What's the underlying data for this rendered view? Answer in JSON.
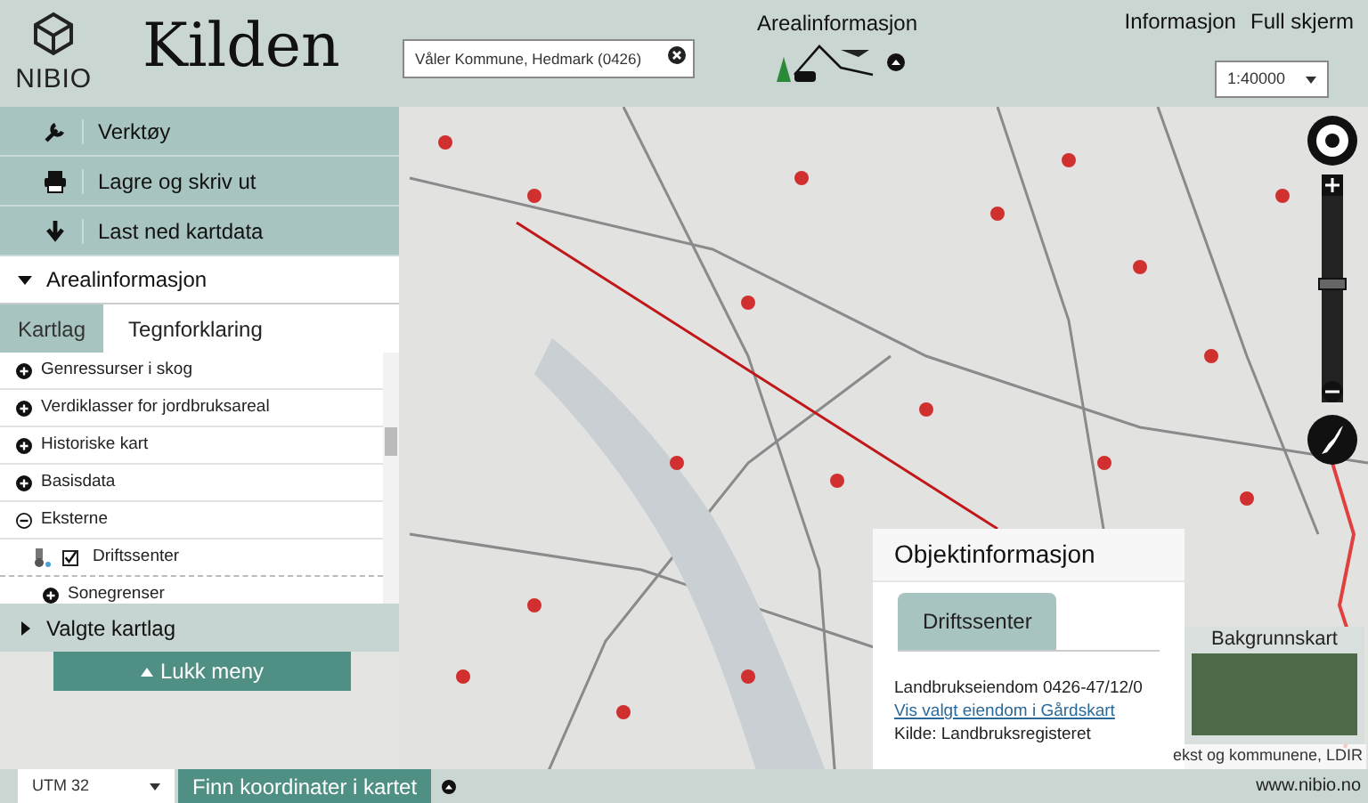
{
  "header": {
    "logo_text": "NIBIO",
    "app_title": "Kilden",
    "search": {
      "value": "Våler Kommune, Hedmark (0426)"
    },
    "theme": {
      "label": "Arealinformasjon"
    },
    "links": [
      "Informasjon",
      "Full skjerm"
    ],
    "scale": {
      "value": "1:40000"
    }
  },
  "menu": {
    "tools": [
      {
        "label": "Verktøy",
        "kind": "wrench"
      },
      {
        "label": "Lagre og skriv ut",
        "kind": "printer"
      },
      {
        "label": "Last ned kartdata",
        "kind": "download"
      }
    ],
    "section": {
      "label": "Arealinformasjon",
      "expanded": true
    },
    "tabs": [
      {
        "label": "Kartlag",
        "selected": true
      },
      {
        "label": "Tegnforklaring",
        "selected": false
      }
    ],
    "layers": [
      {
        "label": "Genressurser i skog",
        "expanded": false
      },
      {
        "label": "Verdiklasser for jordbruksareal",
        "expanded": false
      },
      {
        "label": "Historiske kart",
        "expanded": false
      },
      {
        "label": "Basisdata",
        "expanded": false
      },
      {
        "label": "Eksterne",
        "expanded": true,
        "children": [
          {
            "label": "Driftssenter",
            "kind": "layer",
            "checked": true
          },
          {
            "label": "Sonegrenser",
            "kind": "group",
            "expanded": false
          }
        ]
      }
    ],
    "selected_layers": {
      "label": "Valgte kartlag",
      "expanded": false
    },
    "close_button": "Lukk meny"
  },
  "zoom": {
    "level": 0.53
  },
  "object_info": {
    "title": "Objektinformasjon",
    "tabs": [
      {
        "label": "Driftssenter",
        "selected": true
      }
    ],
    "lines": [
      {
        "kind": "text",
        "text": "Landbrukseiendom 0426-47/12/0"
      },
      {
        "kind": "link",
        "text": "Vis valgt eiendom i Gårdskart"
      },
      {
        "kind": "text",
        "text": "Kilde: Landbruksregisteret"
      }
    ]
  },
  "background_map": {
    "label": "Bakgrunnskart"
  },
  "attribution": "ekst og kommunene, LDIR",
  "footer": {
    "projection": "UTM 32",
    "find_button": "Finn koordinater i kartet",
    "site": "www.nibio.no"
  }
}
